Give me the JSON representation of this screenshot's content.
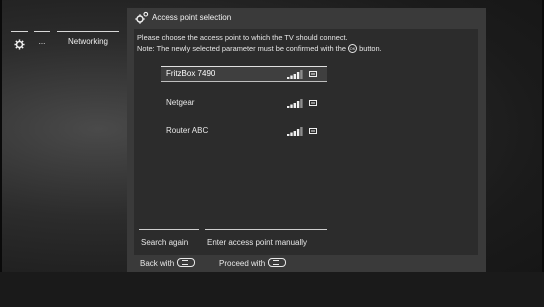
{
  "breadcrumb": {
    "ellipsis": "...",
    "networking": "Networking"
  },
  "dialog": {
    "title": "Access point selection",
    "description_line1": "Please choose the access point to which the TV should connect.",
    "description_line2_prefix": "Note: The newly selected parameter must be confirmed with the",
    "description_line2_suffix": "button.",
    "ok_symbol": "OK",
    "access_points": [
      {
        "name": "FritzBox 7490",
        "selected": true
      },
      {
        "name": "Netgear",
        "selected": false
      },
      {
        "name": "Router ABC",
        "selected": false
      }
    ],
    "buttons": {
      "search_again": "Search again",
      "enter_manually": "Enter access point manually"
    },
    "footer": {
      "back": "Back with",
      "proceed": "Proceed with"
    }
  },
  "colors": {
    "dialog_bg": "#3a3a3a",
    "body_bg": "#2c2c2c",
    "text": "#e8e8e8"
  }
}
